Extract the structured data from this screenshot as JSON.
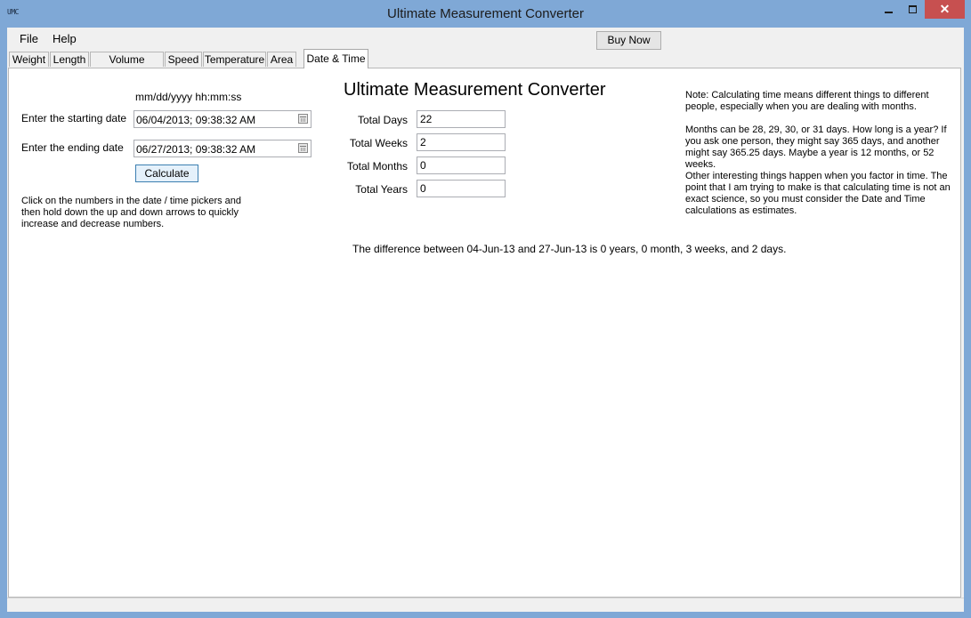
{
  "window": {
    "title": "Ultimate Measurement Converter",
    "icon_text": "UMC",
    "close_glyph": "✕"
  },
  "menu": {
    "file": "File",
    "help": "Help"
  },
  "toolbar": {
    "buy_now": "Buy Now"
  },
  "tabs": [
    "Weight",
    "Length",
    "Volume (Liquid)",
    "Speed",
    "Temperature",
    "Area",
    "Date & Time"
  ],
  "active_tab": "Date & Time",
  "date_time": {
    "format_label": "mm/dd/yyyy  hh:mm:ss",
    "start_label": "Enter the starting date",
    "start_value": "06/04/2013; 09:38:32 AM",
    "end_label": "Enter the ending date",
    "end_value": "06/27/2013; 09:38:32 AM",
    "calculate_label": "Calculate",
    "hint": "Click on the numbers in the date / time pickers and then hold down the up and down arrows to quickly increase and decrease numbers."
  },
  "heading": "Ultimate Measurement Converter",
  "results": {
    "days_label": "Total Days",
    "days_value": "22",
    "weeks_label": "Total Weeks",
    "weeks_value": "2",
    "months_label": "Total Months",
    "months_value": "0",
    "years_label": "Total Years",
    "years_value": "0",
    "summary": "The difference between 04-Jun-13 and 27-Jun-13 is 0 years, 0 month, 3 weeks, and 2 days."
  },
  "notes": {
    "note1": "Note: Calculating time means different things to different people, especially when you are dealing with months.",
    "note2": "Months can be 28, 29, 30, or 31 days. How long is a year? If you ask one person, they might say 365 days, and another might say 365.25 days. Maybe a year is 12 months, or 52 weeks.",
    "note3": "Other interesting things happen when you factor in time. The point that I am trying to make is that calculating time is not an exact science, so you must consider the Date and Time calculations as estimates."
  },
  "colors": {
    "titlebar": "#7fa8d6",
    "close_button": "#c75050",
    "client_bg": "#f0f0f0"
  }
}
